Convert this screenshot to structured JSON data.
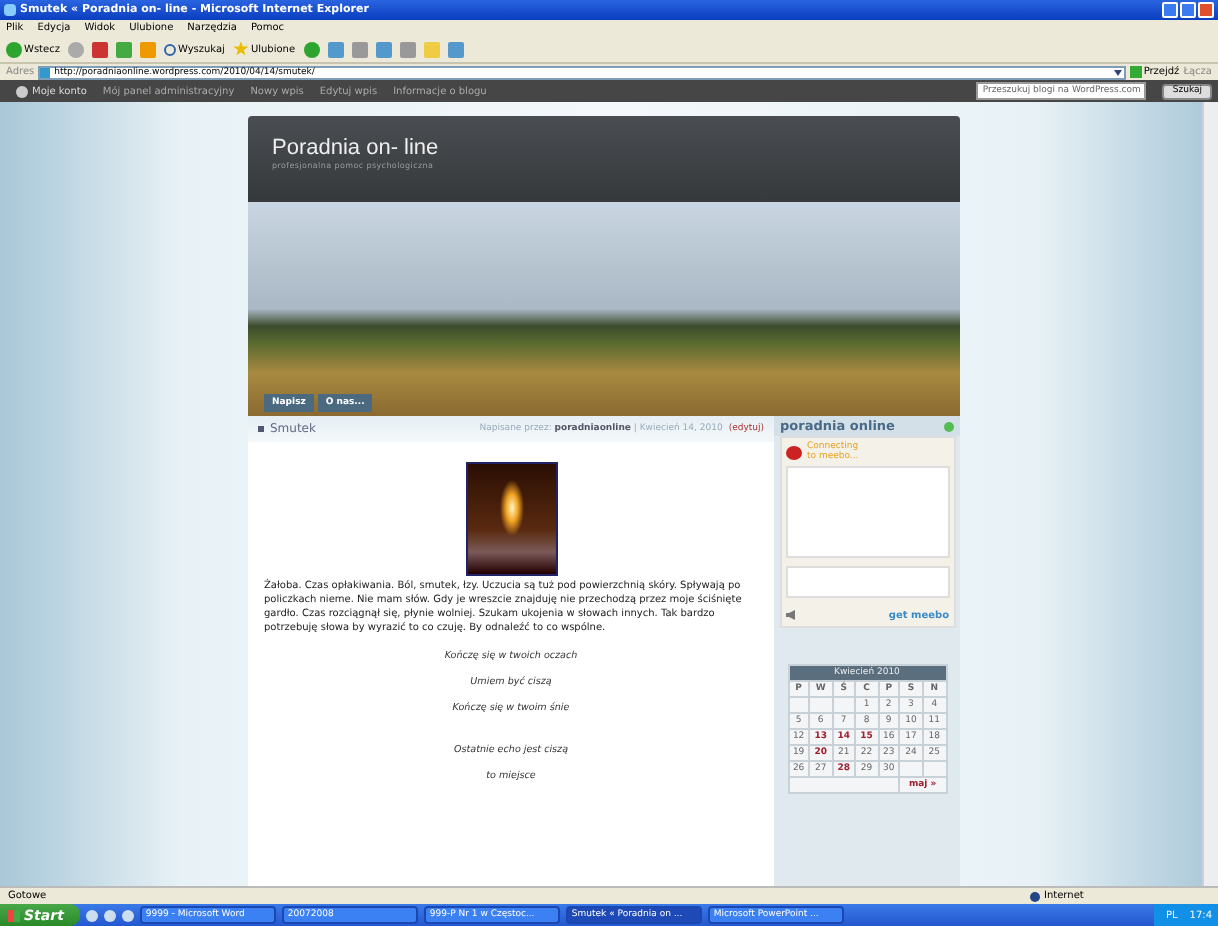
{
  "window": {
    "title": "Smutek « Poradnia on- line - Microsoft Internet Explorer"
  },
  "menu": [
    "Plik",
    "Edycja",
    "Widok",
    "Ulubione",
    "Narzędzia",
    "Pomoc"
  ],
  "toolbar": {
    "back": "Wstecz",
    "search": "Wyszukaj",
    "favorites": "Ulubione"
  },
  "address": {
    "label": "Adres",
    "url": "http://poradniaonline.wordpress.com/2010/04/14/smutek/",
    "go": "Przejdź",
    "links": "Łącza"
  },
  "admin_bar": {
    "account": "Moje konto",
    "links": [
      "Mój panel administracyjny",
      "Nowy wpis",
      "Edytuj wpis",
      "Informacje o blogu"
    ],
    "search_value": "Przeszukuj blogi na WordPress.com",
    "search_button": "Szukaj"
  },
  "blog": {
    "title": "Poradnia on- line",
    "tagline": "profesjonalna pomoc psychologiczna",
    "nav": [
      {
        "label": "Napisz",
        "selected": false
      },
      {
        "label": "O nas...",
        "selected": false
      }
    ]
  },
  "post": {
    "title": "Smutek",
    "meta": "Napisane przez: **poradniaonline** | Kwiecień 14, 2010",
    "edit": "(edytuj)",
    "body": "Żałoba. Czas opłakiwania. Ból, smutek, łzy. Uczucia są tuż pod powierzchnią skóry. Spływają po policzkach nieme. Nie mam słów. Gdy je wreszcie znajduję nie przechodzą przez moje ściśnięte gardło. Czas rozciągnął się, płynie wolniej. Szukam ukojenia w słowach innych. Tak bardzo potrzebuję słowa by wyrazić to co czuję. By odnaleźć to co wspólne.",
    "stanzas": [
      [
        "Kończę się w twoich oczach",
        "Umiem być ciszą",
        "Kończę się w twoim śnie"
      ],
      [
        "Ostatnie echo jest ciszą",
        "to miejsce"
      ]
    ]
  },
  "sidebar": {
    "widget_title": "poradnia online",
    "status": "Connecting to meebo...",
    "get_link": "get meebo",
    "calendar": {
      "caption": "Kwiecień 2010",
      "weekdays": [
        "P",
        "W",
        "Ś",
        "C",
        "P",
        "S",
        "N"
      ],
      "weeks": [
        [
          {
            "day": "1",
            "linked": false
          },
          {
            "day": "2",
            "linked": false
          },
          {
            "day": "3",
            "linked": false
          },
          {
            "day": "4",
            "linked": false
          }
        ],
        [
          {
            "day": "5",
            "linked": false
          },
          {
            "day": "6",
            "linked": false
          },
          {
            "day": "7",
            "linked": false
          },
          {
            "day": "8",
            "linked": false
          },
          {
            "day": "9",
            "linked": false
          },
          {
            "day": "10",
            "linked": false
          },
          {
            "day": "11",
            "linked": false
          }
        ],
        [
          {
            "day": "12",
            "linked": false
          },
          {
            "day": "13",
            "linked": true
          },
          {
            "day": "14",
            "linked": true
          },
          {
            "day": "15",
            "linked": true
          },
          {
            "day": "16",
            "linked": false
          },
          {
            "day": "17",
            "linked": false
          },
          {
            "day": "18",
            "linked": false
          }
        ],
        [
          {
            "day": "19",
            "linked": false
          },
          {
            "day": "20",
            "linked": true
          },
          {
            "day": "21",
            "linked": false
          },
          {
            "day": "22",
            "linked": false
          },
          {
            "day": "23",
            "linked": false
          },
          {
            "day": "24",
            "linked": false
          },
          {
            "day": "25",
            "linked": false
          }
        ],
        [
          {
            "day": "26",
            "linked": false
          },
          {
            "day": "27",
            "linked": false
          },
          {
            "day": "28",
            "linked": true
          },
          {
            "day": "29",
            "linked": false
          },
          {
            "day": "30",
            "linked": false
          }
        ]
      ],
      "next": "maj »"
    }
  },
  "status_bar": {
    "text": "Gotowe",
    "zone": "Internet"
  },
  "taskbar": {
    "start": "Start",
    "tasks": [
      {
        "label": "9999 - Microsoft Word",
        "selected": false
      },
      {
        "label": "20072008",
        "selected": false
      },
      {
        "label": "999-P Nr 1 w Częstoc...",
        "selected": false
      },
      {
        "label": "Smutek « Poradnia on ...",
        "selected": true
      },
      {
        "label": "Microsoft PowerPoint ...",
        "selected": false
      }
    ],
    "lang": "PL",
    "clock": "17:4"
  }
}
